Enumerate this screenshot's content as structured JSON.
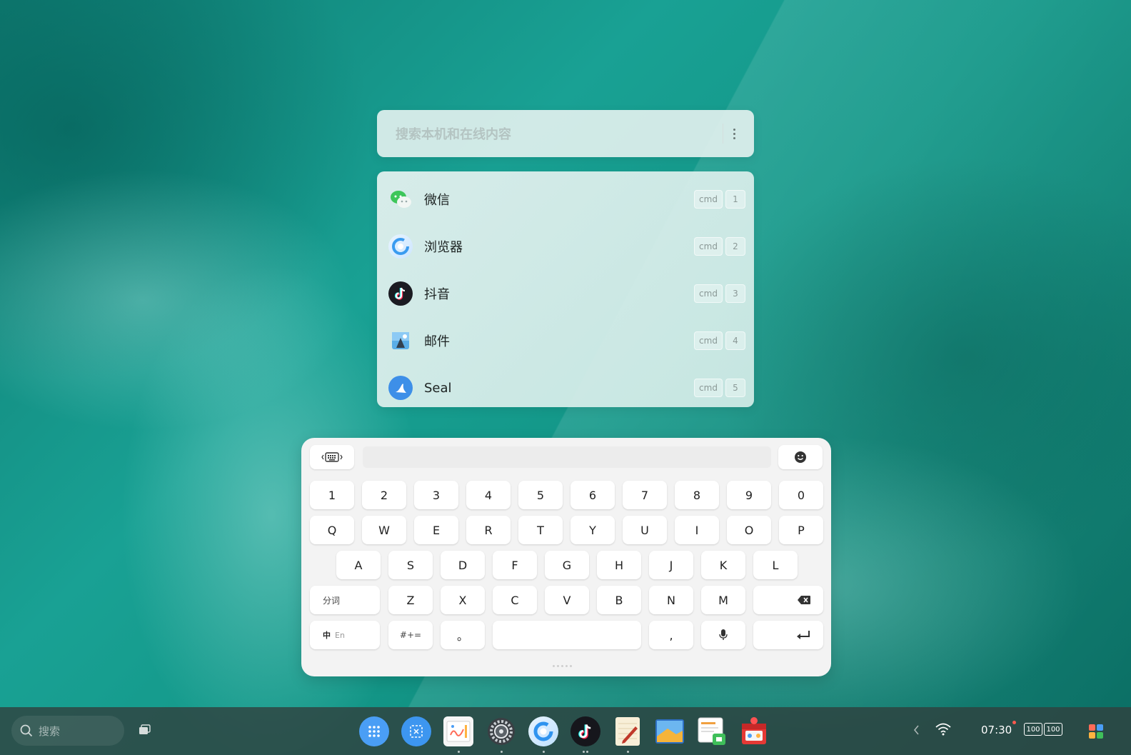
{
  "search": {
    "placeholder": "搜索本机和在线内容"
  },
  "results": [
    {
      "label": "微信",
      "icon": "wechat-icon",
      "cmd": "cmd",
      "num": "1"
    },
    {
      "label": "浏览器",
      "icon": "browser-icon",
      "cmd": "cmd",
      "num": "2"
    },
    {
      "label": "抖音",
      "icon": "douyin-icon",
      "cmd": "cmd",
      "num": "3"
    },
    {
      "label": "邮件",
      "icon": "mail-icon",
      "cmd": "cmd",
      "num": "4"
    },
    {
      "label": "Seal",
      "icon": "seal-icon",
      "cmd": "cmd",
      "num": "5"
    }
  ],
  "keyboard": {
    "row_numbers": [
      "1",
      "2",
      "3",
      "4",
      "5",
      "6",
      "7",
      "8",
      "9",
      "0"
    ],
    "row_q": [
      "Q",
      "W",
      "E",
      "R",
      "T",
      "Y",
      "U",
      "I",
      "O",
      "P"
    ],
    "row_a": [
      "A",
      "S",
      "D",
      "F",
      "G",
      "H",
      "J",
      "K",
      "L"
    ],
    "row_z": [
      "Z",
      "X",
      "C",
      "V",
      "B",
      "N",
      "M"
    ],
    "segment_label": "分词",
    "lang_zh": "中",
    "lang_en": "En",
    "symbols_label": "#+=",
    "period_label": "。",
    "comma_label": ","
  },
  "taskbar": {
    "search_label": "搜索",
    "time": "07:30",
    "battery_1": "100",
    "battery_2": "100",
    "dock_apps": [
      "launcher-icon",
      "screenshot-icon",
      "whiteboard-icon",
      "settings-icon",
      "browser-icon",
      "douyin-icon",
      "notes-icon",
      "gallery-icon",
      "files-icon",
      "app-store-icon"
    ]
  },
  "colors": {
    "accent_blue": "#4a9ef5",
    "wallpaper": "#15988a",
    "taskbar": "#304240"
  }
}
